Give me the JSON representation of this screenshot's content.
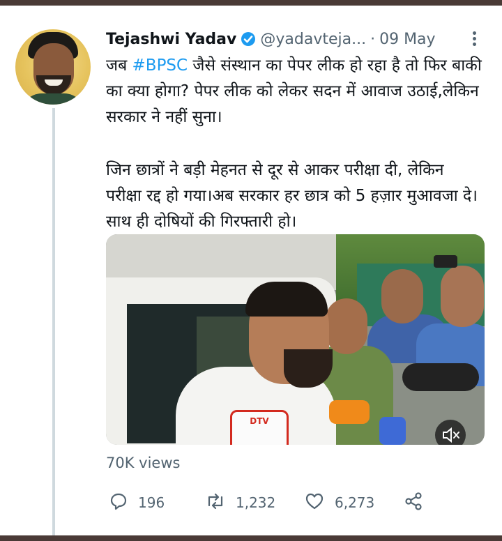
{
  "tweet": {
    "author_name": "Tejashwi Yadav",
    "handle": "@yadavteja...",
    "separator": "·",
    "date": "09 May",
    "paragraph1_before": "जब ",
    "hashtag": "#BPSC",
    "paragraph1_after": " जैसे संस्थान का पेपर लीक हो रहा है तो फिर बाकी का क्या होगा? पेपर लीक को लेकर सदन में आवाज उठाई,लेकिन सरकार ने नहीं सुना।",
    "paragraph2": "जिन छात्रों ने बड़ी मेहनत से दूर से आकर परीक्षा दी, लेकिन परीक्षा रद्द हो गया।अब सरकार हर छात्र को 5 हज़ार मुआवजा दे।साथ ही दोषियों की गिरफ्तारी हो।",
    "views": "70K views",
    "reply_count": "196",
    "retweet_count": "1,232",
    "like_count": "6,273"
  },
  "media": {
    "mic_label": "DTV"
  },
  "colors": {
    "accent": "#1d9bf0",
    "muted_text": "#536471",
    "frame": "#4a3a36"
  },
  "icons": [
    "verified-badge-icon",
    "more-options-icon",
    "reply-icon",
    "retweet-icon",
    "like-icon",
    "share-icon",
    "mute-icon"
  ]
}
